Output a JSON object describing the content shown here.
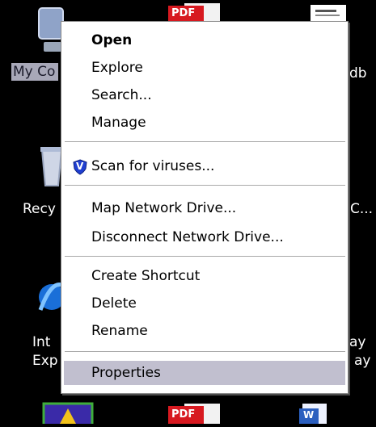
{
  "desktop": {
    "icons": {
      "my_computer_label": "My Co",
      "db_label": "db",
      "recycle_label": "Recy",
      "c_label": "C...",
      "ie_label_line1": "Int",
      "ie_label_line2": "Exp",
      "right_label_line1": "ay",
      "right_label_line2": "ay"
    },
    "pdf_badge": "PDF",
    "word_badge": "W"
  },
  "context_menu": {
    "items": [
      {
        "label": "Open",
        "default": true
      },
      {
        "label": "Explore"
      },
      {
        "label": "Search..."
      },
      {
        "label": "Manage"
      },
      {
        "label": "Scan for viruses...",
        "icon": "antivirus-shield-icon",
        "icon_letter": "V"
      },
      {
        "label": "Map Network Drive..."
      },
      {
        "label": "Disconnect Network Drive..."
      },
      {
        "label": "Create Shortcut"
      },
      {
        "label": "Delete"
      },
      {
        "label": "Rename"
      },
      {
        "label": "Properties",
        "highlighted": true
      }
    ]
  },
  "colors": {
    "desktop_background": "#000000",
    "menu_background": "#ffffff",
    "menu_highlight": "#c1bfcf",
    "shield_blue": "#1f3fd1",
    "pdf_red": "#d71920"
  }
}
